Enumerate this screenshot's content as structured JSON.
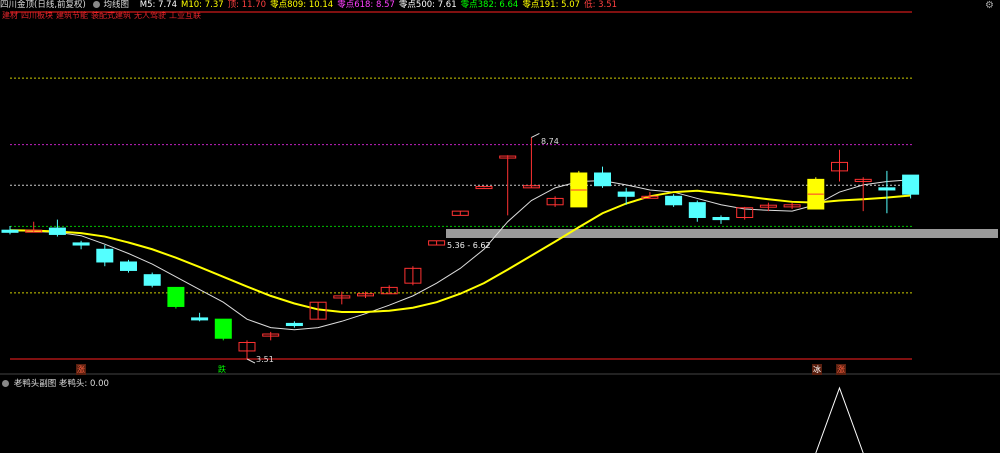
{
  "header": {
    "stock_name": "四川金顶(日线,前复权)",
    "indicator_name": "均线图",
    "items": [
      {
        "label": "M5: 7.74",
        "color": "#ffffff"
      },
      {
        "label": "M10: 7.37",
        "color": "#ffff00"
      },
      {
        "label": "顶: 11.70",
        "color": "#ff4040"
      },
      {
        "label": "零点809: 10.14",
        "color": "#ffff00"
      },
      {
        "label": "零点618: 8.57",
        "color": "#ff40ff"
      },
      {
        "label": "零点500: 7.61",
        "color": "#ffffff"
      },
      {
        "label": "零点382: 6.64",
        "color": "#00ff00"
      },
      {
        "label": "零点191: 5.07",
        "color": "#ffff00"
      },
      {
        "label": "低: 3.51",
        "color": "#ff4040"
      }
    ],
    "tags": [
      "建材",
      "四川板块",
      "建筑节能",
      "装配式建筑",
      "无人驾驶",
      "工业互联"
    ]
  },
  "annotations": {
    "high_price": "8.74",
    "low_price": "3.51",
    "range_label": "5.36 - 6.62",
    "marker_rise_left": "涨",
    "marker_fall": "跌",
    "marker_cold": "冰",
    "marker_rise_right": "涨"
  },
  "sub_panel": {
    "title": "老鸭头副图",
    "value_label": "老鸭头: 0.00"
  },
  "colors": {
    "up_candle": "#ff3232",
    "down_cyan": "#54ffff",
    "yellow_box": "#ffff00",
    "green_box": "#00ff00",
    "ma5": "#dddddd",
    "ma10": "#ffff00",
    "grey_band": "#9a9a9a"
  },
  "chart_data": {
    "type": "candlestick",
    "price_levels": {
      "top": 11.7,
      "z809": 10.14,
      "z618": 8.57,
      "z500": 7.61,
      "z382": 6.64,
      "z191": 5.07,
      "low": 3.51
    },
    "ohlc": [
      {
        "o": 6.55,
        "h": 6.65,
        "l": 6.45,
        "c": 6.5
      },
      {
        "o": 6.55,
        "h": 6.75,
        "l": 6.5,
        "c": 6.55
      },
      {
        "o": 6.6,
        "h": 6.8,
        "l": 6.4,
        "c": 6.45
      },
      {
        "o": 6.25,
        "h": 6.3,
        "l": 6.1,
        "c": 6.2
      },
      {
        "o": 6.1,
        "h": 6.2,
        "l": 5.7,
        "c": 5.8
      },
      {
        "o": 5.8,
        "h": 5.85,
        "l": 5.55,
        "c": 5.6
      },
      {
        "o": 5.5,
        "h": 5.55,
        "l": 5.2,
        "c": 5.25
      },
      {
        "o": 5.2,
        "h": 5.2,
        "l": 4.7,
        "c": 4.75
      },
      {
        "o": 4.48,
        "h": 4.6,
        "l": 4.4,
        "c": 4.45
      },
      {
        "o": 4.45,
        "h": 4.45,
        "l": 3.95,
        "c": 4.0
      },
      {
        "o": 3.7,
        "h": 3.95,
        "l": 3.51,
        "c": 3.9
      },
      {
        "o": 4.05,
        "h": 4.15,
        "l": 3.95,
        "c": 4.1
      },
      {
        "o": 4.35,
        "h": 4.4,
        "l": 4.25,
        "c": 4.3
      },
      {
        "o": 4.45,
        "h": 4.85,
        "l": 4.45,
        "c": 4.85
      },
      {
        "o": 4.95,
        "h": 5.1,
        "l": 4.8,
        "c": 5.0
      },
      {
        "o": 5.0,
        "h": 5.1,
        "l": 4.95,
        "c": 5.05
      },
      {
        "o": 5.05,
        "h": 5.25,
        "l": 5.05,
        "c": 5.2
      },
      {
        "o": 5.3,
        "h": 5.7,
        "l": 5.25,
        "c": 5.65
      },
      {
        "o": 6.2,
        "h": 6.3,
        "l": 6.2,
        "c": 6.3
      },
      {
        "o": 6.9,
        "h": 7.0,
        "l": 6.9,
        "c": 7.0
      },
      {
        "o": 7.58,
        "h": 7.6,
        "l": 7.56,
        "c": 7.58
      },
      {
        "o": 8.3,
        "h": 8.32,
        "l": 6.9,
        "c": 8.3
      },
      {
        "o": 7.55,
        "h": 8.74,
        "l": 7.55,
        "c": 7.6
      },
      {
        "o": 7.15,
        "h": 7.35,
        "l": 7.1,
        "c": 7.3
      },
      {
        "o": 7.1,
        "h": 7.95,
        "l": 7.1,
        "c": 7.9
      },
      {
        "o": 7.9,
        "h": 8.05,
        "l": 7.55,
        "c": 7.6
      },
      {
        "o": 7.45,
        "h": 7.55,
        "l": 7.15,
        "c": 7.35
      },
      {
        "o": 7.35,
        "h": 7.45,
        "l": 7.3,
        "c": 7.35
      },
      {
        "o": 7.35,
        "h": 7.4,
        "l": 7.1,
        "c": 7.15
      },
      {
        "o": 7.2,
        "h": 7.25,
        "l": 6.75,
        "c": 6.85
      },
      {
        "o": 6.85,
        "h": 6.9,
        "l": 6.7,
        "c": 6.8
      },
      {
        "o": 6.85,
        "h": 7.1,
        "l": 6.8,
        "c": 7.08
      },
      {
        "o": 7.12,
        "h": 7.2,
        "l": 7.0,
        "c": 7.14
      },
      {
        "o": 7.1,
        "h": 7.2,
        "l": 7.05,
        "c": 7.15
      },
      {
        "o": 7.05,
        "h": 7.8,
        "l": 7.05,
        "c": 7.75
      },
      {
        "o": 7.95,
        "h": 8.45,
        "l": 7.7,
        "c": 8.15
      },
      {
        "o": 7.7,
        "h": 7.8,
        "l": 7.0,
        "c": 7.75
      },
      {
        "o": 7.55,
        "h": 7.95,
        "l": 6.95,
        "c": 7.5
      },
      {
        "o": 7.85,
        "h": 7.85,
        "l": 7.3,
        "c": 7.4
      }
    ],
    "ma5": [
      6.55,
      6.52,
      6.5,
      6.42,
      6.22,
      6.0,
      5.75,
      5.45,
      5.15,
      4.85,
      4.45,
      4.25,
      4.2,
      4.25,
      4.4,
      4.58,
      4.78,
      5.0,
      5.3,
      5.65,
      6.1,
      6.75,
      7.25,
      7.55,
      7.7,
      7.72,
      7.62,
      7.5,
      7.45,
      7.3,
      7.15,
      7.05,
      7.02,
      7.0,
      7.15,
      7.45,
      7.62,
      7.7,
      7.74
    ],
    "ma10": [
      6.55,
      6.54,
      6.52,
      6.48,
      6.4,
      6.26,
      6.1,
      5.9,
      5.68,
      5.45,
      5.22,
      5.0,
      4.82,
      4.68,
      4.62,
      4.62,
      4.65,
      4.72,
      4.85,
      5.05,
      5.3,
      5.62,
      5.95,
      6.28,
      6.62,
      6.95,
      7.18,
      7.35,
      7.45,
      7.48,
      7.42,
      7.35,
      7.28,
      7.22,
      7.2,
      7.25,
      7.28,
      7.32,
      7.37
    ],
    "oscillator": [
      {
        "index": 34,
        "value": 0
      },
      {
        "index": 35,
        "value": 1
      },
      {
        "index": 36,
        "value": 0
      }
    ]
  }
}
